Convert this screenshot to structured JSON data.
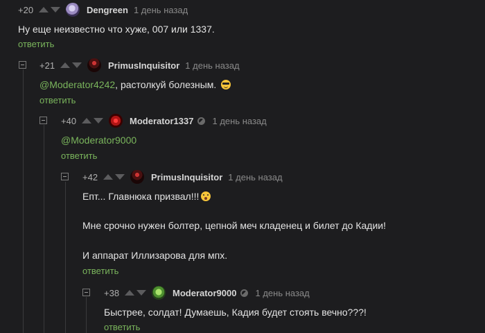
{
  "reply_label": "ответить",
  "comments": [
    {
      "rating": "+20",
      "username": "Dengreen",
      "time": "1 день назад",
      "text": "Ну еще неизвестно что хуже, 007 или 1337."
    },
    {
      "rating": "+21",
      "username": "PrimusInquisitor",
      "time": "1 день назад",
      "mention": "@Moderator4242",
      "text": ", растолкуй болезным.",
      "emoji": "smiling-face-with-sunglasses"
    },
    {
      "rating": "+40",
      "username": "Moderator1337",
      "time": "1 день назад",
      "mention": "@Moderator9000"
    },
    {
      "rating": "+42",
      "username": "PrimusInquisitor",
      "time": "1 день назад",
      "line1": "Епт... Главнюка призвал!!!",
      "emoji": "astonished-face",
      "line2": "Мне срочно нужен болтер, цепной меч кладенец и билет до Кадии!",
      "line3": "И аппарат Иллизарова для мпх."
    },
    {
      "rating": "+38",
      "username": "Moderator9000",
      "time": "1 день назад",
      "text": "Быстрее, солдат! Думаешь, Кадия будет стоять вечно???!"
    }
  ]
}
